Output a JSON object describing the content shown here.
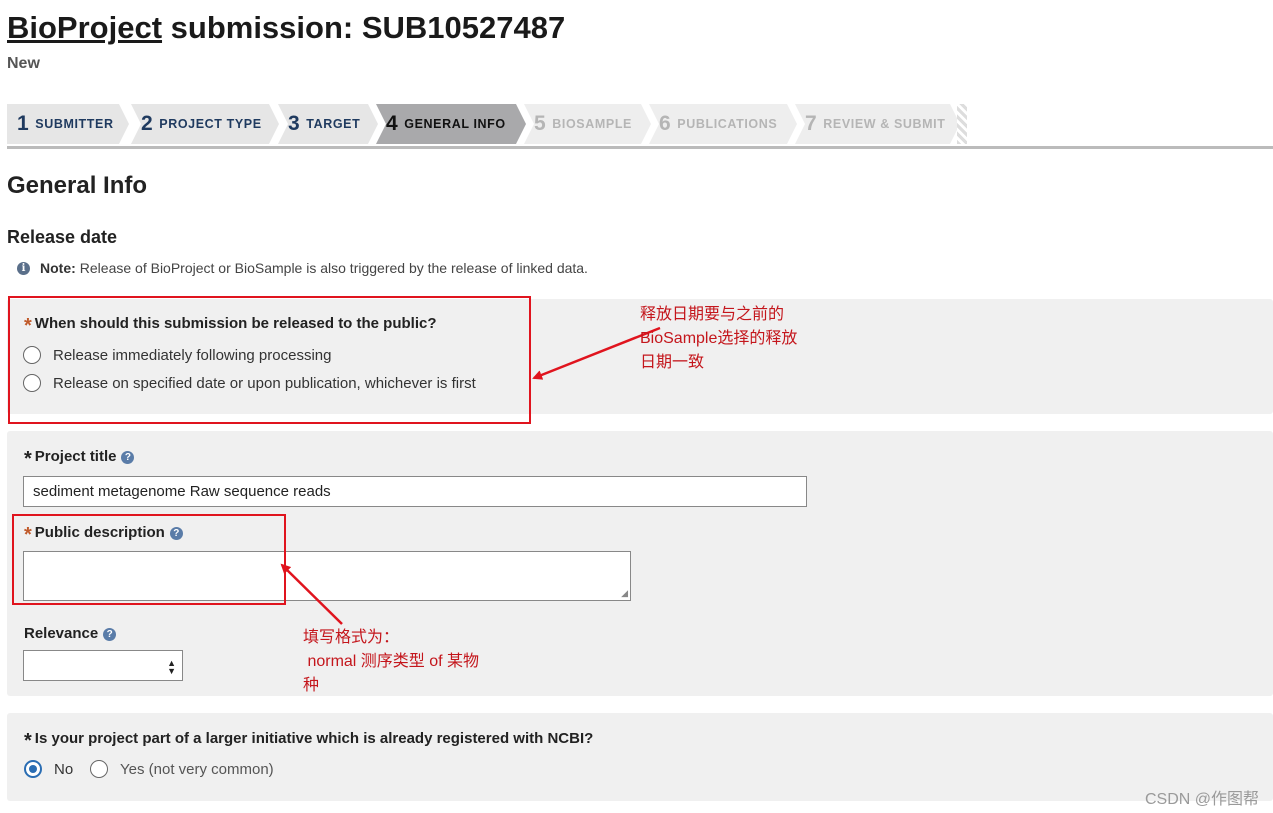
{
  "header": {
    "title_link": "BioProject",
    "title_rest": " submission: SUB10527487",
    "status": "New"
  },
  "steps": [
    {
      "num": "1",
      "label": "SUBMITTER",
      "state": "done"
    },
    {
      "num": "2",
      "label": "PROJECT TYPE",
      "state": "done"
    },
    {
      "num": "3",
      "label": "TARGET",
      "state": "done"
    },
    {
      "num": "4",
      "label": "GENERAL INFO",
      "state": "active"
    },
    {
      "num": "5",
      "label": "BIOSAMPLE",
      "state": "future"
    },
    {
      "num": "6",
      "label": "PUBLICATIONS",
      "state": "future"
    },
    {
      "num": "7",
      "label": "REVIEW & SUBMIT",
      "state": "future"
    }
  ],
  "section": {
    "title": "General Info",
    "release_heading": "Release date",
    "note_label": "Note:",
    "note_text": "Release of BioProject or BioSample is also triggered by the release of linked data."
  },
  "release": {
    "question": "When should this submission be released to the public?",
    "options": [
      "Release immediately following processing",
      "Release on specified date or upon publication, whichever is first"
    ]
  },
  "project": {
    "title_label": "Project title",
    "title_value": "sediment metagenome Raw sequence reads",
    "description_label": "Public description",
    "description_value": "",
    "relevance_label": "Relevance",
    "relevance_value": ""
  },
  "initiative": {
    "question": "Is your project part of a larger initiative which is already registered with NCBI?",
    "options": [
      "No",
      "Yes (not very common)"
    ],
    "selected": "No"
  },
  "annotations": {
    "release_note": "释放日期要与之前的\nBioSample选择的释放\n日期一致",
    "description_note": "填写格式为：\n normal 测序类型 of 某物\n种"
  },
  "watermark": "CSDN @作图帮",
  "icons": {
    "info": "info-circle-icon",
    "help": "question-circle-icon"
  },
  "colors": {
    "accent": "#2a6db3",
    "annotation_red": "#e0141e",
    "required_star": "#c05a2a"
  }
}
